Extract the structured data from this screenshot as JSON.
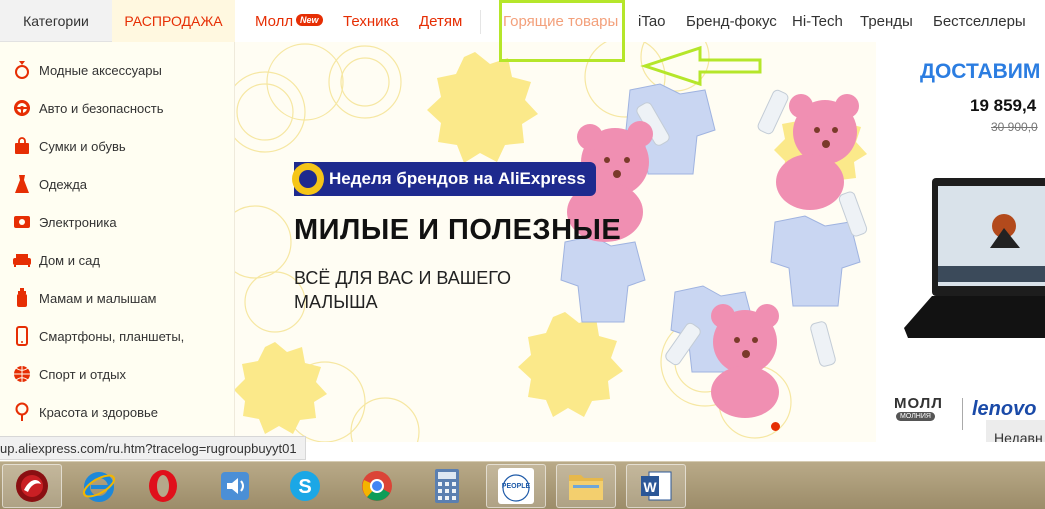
{
  "header": {
    "cat_tabs": [
      "Категории",
      "РАСПРОДАЖА"
    ],
    "nav": {
      "mall": "Молл",
      "new_badge": "New",
      "tech": "Техника",
      "kids": "Детям",
      "hot": "Горящие товары",
      "itao": "iTao",
      "brand": "Бренд-фокус",
      "hitech": "Hi-Tech",
      "trends": "Тренды",
      "bestsellers": "Бестселлеры"
    }
  },
  "sidebar": {
    "items": [
      {
        "label": "Модные аксессуары",
        "icon": "ring-icon"
      },
      {
        "label": "Авто и безопасность",
        "icon": "steering-wheel-icon"
      },
      {
        "label": "Сумки и обувь",
        "icon": "bag-icon"
      },
      {
        "label": "Одежда",
        "icon": "dress-icon"
      },
      {
        "label": "Электроника",
        "icon": "camera-icon"
      },
      {
        "label": "Дом и сад",
        "icon": "sofa-icon"
      },
      {
        "label": "Мамам и малышам",
        "icon": "baby-bottle-icon"
      },
      {
        "label": "Смартфоны, планшеты,",
        "icon": "smartphone-icon"
      },
      {
        "label": "Спорт и отдых",
        "icon": "ball-icon"
      },
      {
        "label": "Красота и здоровье",
        "icon": "mirror-icon"
      }
    ]
  },
  "banner": {
    "badge": "Неделя брендов на AliExpress",
    "headline": "МИЛЫЕ И ПОЛЕЗНЫЕ",
    "subline_1": "ВСЁ ДЛЯ ВАС И ВАШЕГО",
    "subline_2": "МАЛЫША"
  },
  "promo": {
    "title": "ДОСТАВИМ",
    "price": "19 859,4",
    "old_price": "30 900,0",
    "mall": "МОЛЛ",
    "molnia": "МОЛНИЯ",
    "brand": "lenovo",
    "recent": "Недавн"
  },
  "status_url": "up.aliexpress.com/ru.htm?tracelog=rugroupbuyyt01",
  "taskbar": {
    "apps": [
      "comodo-dragon-icon",
      "internet-explorer-icon",
      "opera-icon",
      "speaker-icon",
      "skype-icon",
      "chrome-icon",
      "calculator-icon",
      "people-icon",
      "folder-icon",
      "word-icon"
    ]
  },
  "colors": {
    "accent": "#e62e04",
    "highlight": "#b5e62a",
    "brand_blue": "#1e2a8e"
  }
}
